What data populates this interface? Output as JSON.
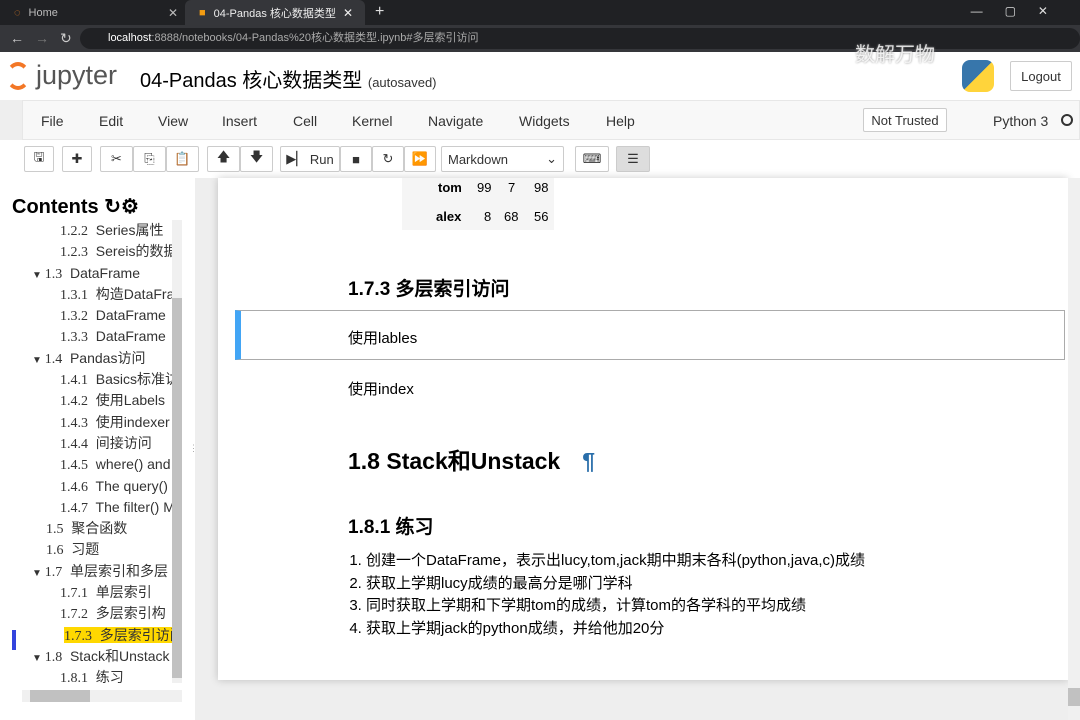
{
  "browser": {
    "tabs": [
      {
        "label": "Home"
      },
      {
        "label": "04-Pandas 核心数据类型"
      }
    ],
    "url_host": "localhost",
    "url_rest": ":8888/notebooks/04-Pandas%20核心数据类型.ipynb#多层索引访问"
  },
  "header": {
    "logo": "jupyter",
    "title": "04-Pandas 核心数据类型",
    "status": "(autosaved)",
    "logout": "Logout",
    "watermark": "数解万物"
  },
  "menu": [
    "File",
    "Edit",
    "View",
    "Insert",
    "Cell",
    "Kernel",
    "Navigate",
    "Widgets",
    "Help"
  ],
  "trust": "Not Trusted",
  "kernel": "Python 3",
  "toolbar": {
    "run": "Run",
    "cell_type": "Markdown"
  },
  "sidebar": {
    "title": "Contents",
    "items": [
      {
        "n": "1.2.2",
        "t": "Series属性",
        "lvl": 2
      },
      {
        "n": "1.2.3",
        "t": "Sereis的数据",
        "lvl": 2
      },
      {
        "n": "1.3",
        "t": "DataFrame",
        "lvl": 1,
        "open": true
      },
      {
        "n": "1.3.1",
        "t": "构造DataFrame",
        "lvl": 2
      },
      {
        "n": "1.3.2",
        "t": "DataFrame",
        "lvl": 2
      },
      {
        "n": "1.3.3",
        "t": "DataFrame",
        "lvl": 2
      },
      {
        "n": "1.4",
        "t": "Pandas访问",
        "lvl": 1,
        "open": true
      },
      {
        "n": "1.4.1",
        "t": "Basics标准访问",
        "lvl": 2
      },
      {
        "n": "1.4.2",
        "t": "使用Labels",
        "lvl": 2
      },
      {
        "n": "1.4.3",
        "t": "使用indexer",
        "lvl": 2
      },
      {
        "n": "1.4.4",
        "t": "间接访问",
        "lvl": 2
      },
      {
        "n": "1.4.5",
        "t": "where() and",
        "lvl": 2
      },
      {
        "n": "1.4.6",
        "t": "The query()",
        "lvl": 2
      },
      {
        "n": "1.4.7",
        "t": "The filter() M",
        "lvl": 2
      },
      {
        "n": "1.5",
        "t": "聚合函数",
        "lvl": 1
      },
      {
        "n": "1.6",
        "t": "习题",
        "lvl": 1
      },
      {
        "n": "1.7",
        "t": "单层索引和多层",
        "lvl": 1,
        "open": true
      },
      {
        "n": "1.7.1",
        "t": "单层索引",
        "lvl": 2
      },
      {
        "n": "1.7.2",
        "t": "多层索引构",
        "lvl": 2
      },
      {
        "n": "1.7.3",
        "t": "多层索引访问",
        "lvl": 2,
        "active": true
      },
      {
        "n": "1.8",
        "t": "Stack和Unstack",
        "lvl": 1,
        "open": true
      },
      {
        "n": "1.8.1",
        "t": "练习",
        "lvl": 2
      }
    ]
  },
  "table": [
    [
      "tom",
      "99",
      "7",
      "98"
    ],
    [
      "alex",
      "8",
      "68",
      "56"
    ]
  ],
  "cells": {
    "h173": "1.7.3  多层索引访问",
    "p1": "使用lables",
    "p2": "使用index",
    "h18": "1.8  Stack和Unstack",
    "pilcrow": "¶",
    "h181": "1.8.1  练习",
    "list": [
      "创建一个DataFrame，表示出lucy,tom,jack期中期末各科(python,java,c)成绩",
      "获取上学期lucy成绩的最高分是哪门学科",
      "同时获取上学期和下学期tom的成绩，计算tom的各学科的平均成绩",
      "获取上学期jack的python成绩，并给他加20分"
    ]
  },
  "colors": {
    "accent": "#42a5f5",
    "highlight": "#ffd800"
  }
}
